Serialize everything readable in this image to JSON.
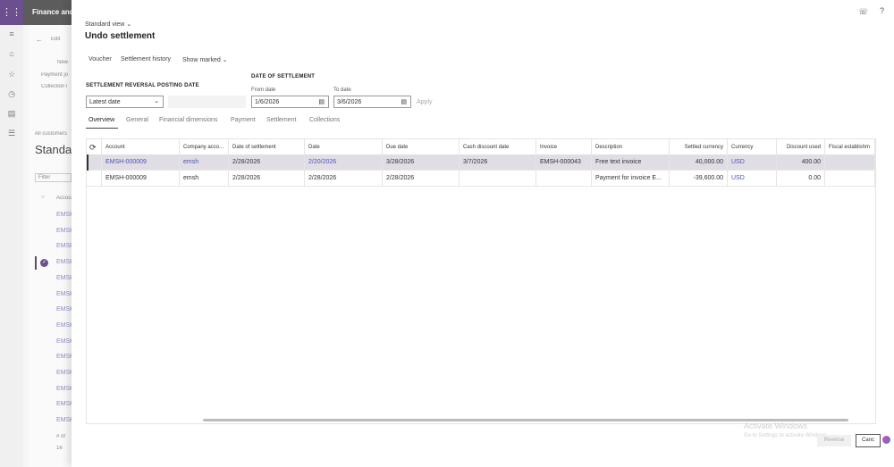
{
  "background": {
    "app_title": "Finance and",
    "edit": "Edit",
    "new": "New",
    "payment": "Payment jo",
    "collection": "Collection l",
    "all_customers": "All customers",
    "view": "Standa",
    "filter_placeholder": "Filter",
    "account_col": "Account",
    "rows": [
      "EMSH",
      "EMSH",
      "EMSH",
      "EMSH",
      "EMSH",
      "EMSH",
      "EMSH",
      "EMSH",
      "EMSH",
      "EMSH",
      "EMSH",
      "EMSH",
      "EMSH",
      "EMSH"
    ],
    "footer1": "# of",
    "footer2": "16"
  },
  "dialog": {
    "view": "Standard view",
    "title": "Undo settlement",
    "toolbar": {
      "voucher": "Voucher",
      "history": "Settlement history",
      "show_marked": "Show marked"
    },
    "reversal_label": "SETTLEMENT REVERSAL POSTING DATE",
    "reversal_value": "Latest date",
    "date_label": "DATE OF SETTLEMENT",
    "from_label": "From date",
    "from_value": "1/6/2026",
    "to_label": "To date",
    "to_value": "3/6/2026",
    "apply": "Apply",
    "tabs": [
      "Overview",
      "General",
      "Financial dimensions",
      "Payment",
      "Settlement",
      "Collections"
    ],
    "grid": {
      "headers": [
        "Account",
        "Company acco...",
        "Date of settlement",
        "Date",
        "Due date",
        "Cash discount date",
        "Invoice",
        "Description",
        "Settled currency",
        "Currency",
        "Discount used",
        "Fiscal establishm"
      ],
      "rows": [
        [
          "EMSH-000009",
          "emsh",
          "2/28/2026",
          "2/20/2026",
          "3/28/2026",
          "3/7/2026",
          "EMSH-000043",
          "Free text invoice",
          "40,000.00",
          "USD",
          "400.00",
          ""
        ],
        [
          "EMSH-000009",
          "emsh",
          "2/28/2026",
          "2/28/2026",
          "2/28/2026",
          "",
          "",
          "Payment for invoice E...",
          "-39,600.00",
          "USD",
          "0.00",
          ""
        ]
      ]
    },
    "reverse": "Reverse",
    "cancel": "Canc",
    "watermark1": "Activate Windows",
    "watermark2": "Go to Settings to activate Windows."
  },
  "colors": {
    "accent": "#6b4f8e",
    "link": "#4b52b3",
    "selected": "#e0dde5"
  }
}
